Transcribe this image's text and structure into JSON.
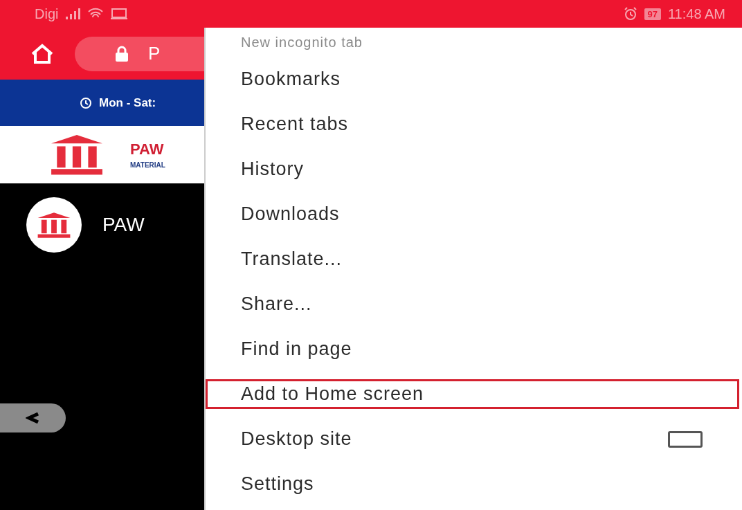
{
  "status_bar": {
    "carrier": "Digi",
    "battery": "97",
    "time": "11:48 AM"
  },
  "page": {
    "address_text": "P",
    "hours_text": "Mon - Sat:",
    "brand_title": "PAW",
    "brand_subtitle": "MATERIAL",
    "hero_title": "PAW"
  },
  "menu": {
    "items": [
      {
        "kind": "item",
        "label": "New incognito tab",
        "highlighted": false
      },
      {
        "kind": "item",
        "label": "Bookmarks",
        "highlighted": false
      },
      {
        "kind": "item",
        "label": "Recent tabs",
        "highlighted": false
      },
      {
        "kind": "item",
        "label": "History",
        "highlighted": false
      },
      {
        "kind": "item",
        "label": "Downloads",
        "highlighted": false
      },
      {
        "kind": "item",
        "label": "Translate...",
        "highlighted": false
      },
      {
        "kind": "item",
        "label": "Share...",
        "highlighted": false
      },
      {
        "kind": "item",
        "label": "Find in page",
        "highlighted": false
      },
      {
        "kind": "item",
        "label": "Add to Home screen",
        "highlighted": true
      },
      {
        "kind": "checkbox",
        "label": "Desktop site",
        "highlighted": false,
        "checked": false
      },
      {
        "kind": "item",
        "label": "Settings",
        "highlighted": false
      }
    ]
  }
}
